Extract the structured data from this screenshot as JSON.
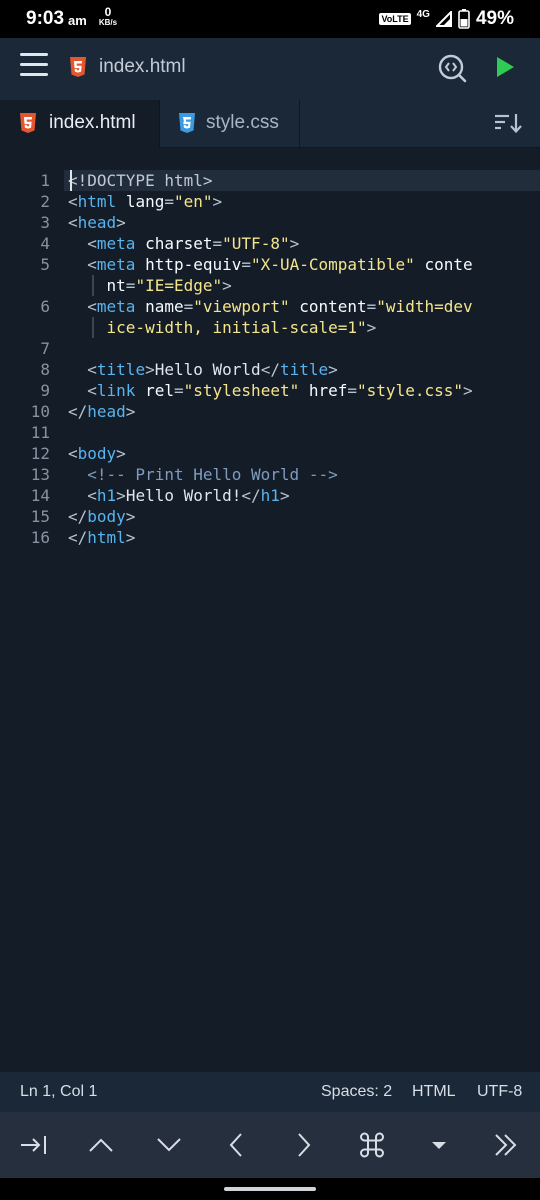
{
  "status_bar": {
    "time": "9:03",
    "ampm": "am",
    "net_speed": "0",
    "net_unit": "KB/s",
    "volte": "VoLTE",
    "network": "4G",
    "battery": "49%"
  },
  "toolbar": {
    "file_title": "index.html"
  },
  "tabs": [
    {
      "label": "index.html",
      "icon": "html5-icon"
    },
    {
      "label": "style.css",
      "icon": "css3-icon"
    }
  ],
  "editor": {
    "line_numbers": [
      "1",
      "2",
      "3",
      "4",
      "5",
      "6",
      "7",
      "8",
      "9",
      "10",
      "11",
      "12",
      "13",
      "14",
      "15",
      "16"
    ],
    "lines": [
      "<!DOCTYPE html>",
      "<html lang=\"en\">",
      "<head>",
      "  <meta charset=\"UTF-8\">",
      "  <meta http-equiv=\"X-UA-Compatible\" content=\"IE=Edge\">",
      "  <meta name=\"viewport\" content=\"width=device-width, initial-scale=1\">",
      "",
      "  <title>Hello World</title>",
      "  <link rel=\"stylesheet\" href=\"style.css\">",
      "</head>",
      "",
      "<body>",
      "  <!-- Print Hello World -->",
      "  <h1>Hello World!</h1>",
      "</body>",
      "</html>"
    ]
  },
  "footer": {
    "position": "Ln 1, Col 1",
    "spaces": "Spaces: 2",
    "language": "HTML",
    "encoding": "UTF-8"
  },
  "keys": [
    {
      "name": "tab-key",
      "icon": "tab-icon"
    },
    {
      "name": "up-key",
      "icon": "chevron-up-icon"
    },
    {
      "name": "down-key",
      "icon": "chevron-down-icon"
    },
    {
      "name": "left-key",
      "icon": "chevron-left-icon"
    },
    {
      "name": "right-key",
      "icon": "chevron-right-icon"
    },
    {
      "name": "command-key",
      "icon": "command-icon"
    },
    {
      "name": "dropdown-key",
      "icon": "caret-down-icon"
    },
    {
      "name": "more-key",
      "icon": "double-chevron-right-icon"
    }
  ],
  "colors": {
    "background": "#141c28",
    "toolbar": "#1b2838",
    "tag": "#58b4ee",
    "string": "#f4e58c",
    "comment": "#7f9bc0",
    "run": "#2ecc52",
    "html5": "#e4572e",
    "css3": "#3b9ae1"
  }
}
